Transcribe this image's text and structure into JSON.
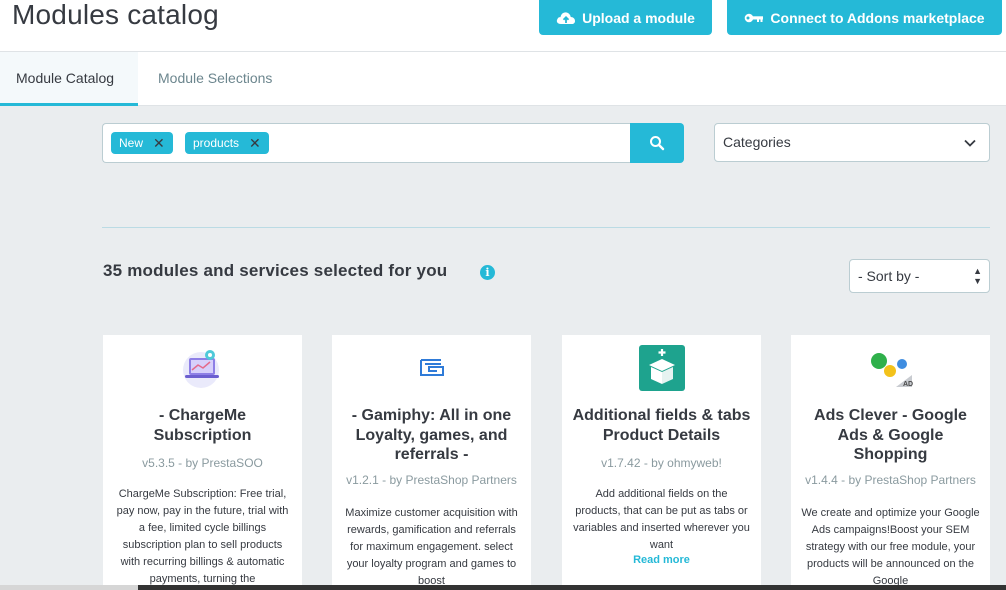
{
  "header": {
    "title": "Modules catalog",
    "upload_label": "Upload a module",
    "connect_label": "Connect to Addons marketplace"
  },
  "tabs": [
    {
      "label": "Module Catalog",
      "active": true
    },
    {
      "label": "Module Selections",
      "active": false
    }
  ],
  "search": {
    "tags": [
      "New",
      "products"
    ],
    "button_icon": "search-icon"
  },
  "categories": {
    "selected": "Categories"
  },
  "results": {
    "count_text": "35 modules and services selected for you",
    "sort_selected": "- Sort by -"
  },
  "cards": [
    {
      "title": "- ChargeMe Subscription",
      "version": "v5.3.5 - by PrestaSOO",
      "description": "ChargeMe Subscription: Free trial, pay now, pay in the future, trial with a fee, limited cycle billings subscription plan to sell products with recurring billings & automatic payments, turning the",
      "logo": "laptop-cart-icon"
    },
    {
      "title": "- Gamiphy: All in one Loyalty, games, and referrals -",
      "version": "v1.2.1 - by PrestaShop Partners",
      "description": "Maximize customer acquisition with rewards, gamification and referrals for maximum engagement. select your loyalty program and games to boost",
      "logo": "gamiphy-logo"
    },
    {
      "title": "Additional fields & tabs Product Details",
      "version": "v1.7.42 - by ohmyweb!",
      "description": "Add additional fields on the products, that can be put as tabs or variables and inserted wherever you want",
      "read_more": "Read more",
      "logo": "box-plus-icon"
    },
    {
      "title": "Ads Clever - Google Ads & Google Shopping",
      "version": "v1.4.4 - by PrestaShop Partners",
      "description": "We create and optimize your Google Ads campaigns!Boost your SEM strategy with our free module, your products will be announced on the Google",
      "logo": "ads-clever-logo"
    }
  ],
  "colors": {
    "accent": "#25b9d7",
    "background": "#eaedef",
    "text": "#363a41"
  }
}
